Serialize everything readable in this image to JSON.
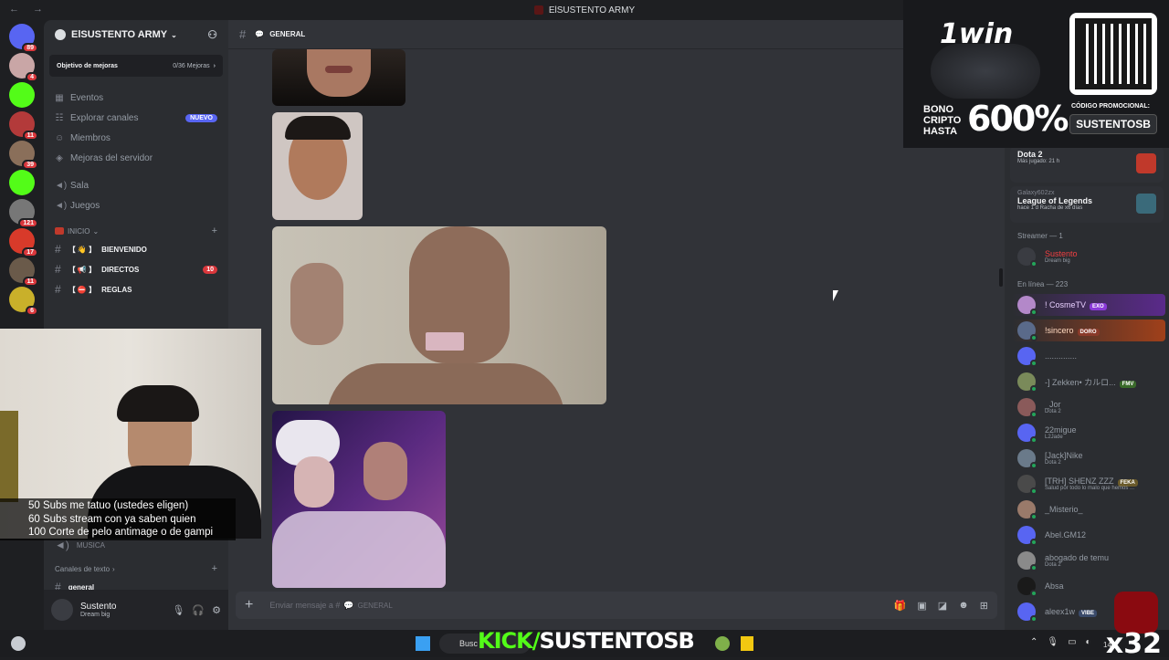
{
  "window": {
    "title": "ElSUSTENTO ARMY",
    "nav": "←  →"
  },
  "servers": [
    {
      "badge": "89",
      "color": "#5865f2"
    },
    {
      "badge": "4",
      "color": "#c9a6a6"
    },
    {
      "badge": "",
      "color": "#53fc18"
    },
    {
      "badge": "11",
      "color": "#b33a3a"
    },
    {
      "badge": "39",
      "color": "#8a6f5a"
    },
    {
      "badge": "",
      "color": "#53fc18"
    },
    {
      "badge": "121",
      "color": "#777"
    },
    {
      "badge": "17",
      "color": "#d83a2a"
    },
    {
      "badge": "11",
      "color": "#6a5a4a"
    },
    {
      "badge": "6",
      "color": "#c9b02a"
    }
  ],
  "sidebar": {
    "server_name": "ElSUSTENTO ARMY",
    "goal": {
      "label": "Objetivo de mejoras",
      "count": "0/36 Mejoras"
    },
    "nav": [
      {
        "label": "Eventos",
        "icon": "calendar-icon",
        "glyph": "▦"
      },
      {
        "label": "Explorar canales",
        "icon": "explore-icon",
        "glyph": "☷",
        "pill": "NUEVO"
      },
      {
        "label": "Miembros",
        "icon": "members-icon",
        "glyph": "☺"
      },
      {
        "label": "Mejoras del servidor",
        "icon": "boost-icon",
        "glyph": "◈"
      }
    ],
    "voice": [
      {
        "label": "Sala",
        "glyph": "◄)"
      },
      {
        "label": "Juegos",
        "glyph": "◄)"
      }
    ],
    "category_inicio": "INICIO",
    "channels": [
      {
        "label": "BIENVENIDO",
        "emoji": "【 👋 】",
        "count": ""
      },
      {
        "label": "DIRECTOS",
        "emoji": "【 📢 】",
        "count": "10"
      },
      {
        "label": "REGLAS",
        "emoji": "【 ⛔ 】",
        "count": ""
      }
    ],
    "channel_musica": "MUSICA",
    "category_text": "Canales de texto",
    "channel_general": "general"
  },
  "user": {
    "name": "Sustento",
    "status": "Dream big"
  },
  "chat": {
    "channel": "GENERAL",
    "composer_placeholder": "Enviar mensaje a #",
    "composer_channel": "GENERAL"
  },
  "members": {
    "activities": [
      {
        "user": "",
        "game": "Dota 2",
        "meta": "Más jugado: 21 h",
        "color": "#c0392b"
      },
      {
        "user": "Galaxy602zx",
        "game": "League of Legends",
        "meta": "hace 1 d   Racha de x6 días",
        "color": "#3a6a7a"
      }
    ],
    "streamer_header": "Streamer — 1",
    "streamer": {
      "name": "Sustento",
      "status": "Dream big"
    },
    "online_header": "En línea — 223",
    "online": [
      {
        "name": "! CosmeTV",
        "status": "",
        "tag": "EXO",
        "tagcolor": "#8a3ad8",
        "avcolor": "#b388c9",
        "glow": "#5a2a8a",
        "namecolor": "#e8d0ff"
      },
      {
        "name": "!sincero",
        "status": "",
        "tag": "DORO",
        "tagcolor": "#8a3a2a",
        "avcolor": "#5a6a8a",
        "glow": "#a0401a",
        "namecolor": "#ffd9c0"
      },
      {
        "name": "..............",
        "status": "",
        "tag": "",
        "tagcolor": "",
        "avcolor": "#5865f2",
        "glow": "",
        "namecolor": "#949ba4"
      },
      {
        "name": "-] Zekken• カルロ...",
        "status": "",
        "tag": "FMV",
        "tagcolor": "#3a6a2a",
        "avcolor": "#7a8a5a",
        "glow": "",
        "namecolor": "#949ba4"
      },
      {
        "name": "_Jor",
        "status": "Dota 2",
        "tag": "",
        "tagcolor": "",
        "avcolor": "#8a5a5a",
        "glow": "",
        "namecolor": "#949ba4"
      },
      {
        "name": "22migue",
        "status": "L2Jade",
        "tag": "",
        "tagcolor": "",
        "avcolor": "#5865f2",
        "glow": "",
        "namecolor": "#949ba4"
      },
      {
        "name": "[Jack]Nike",
        "status": "Dota 2",
        "tag": "",
        "tagcolor": "",
        "avcolor": "#6a7a8a",
        "glow": "",
        "namecolor": "#949ba4"
      },
      {
        "name": "[TRH] SHENZ ZZZ",
        "status": "Salud por todo lo malo que hemos ...",
        "tag": "FEKA",
        "tagcolor": "#6a5a2a",
        "avcolor": "#4a4a4a",
        "glow": "",
        "namecolor": "#949ba4"
      },
      {
        "name": "_Misterio_",
        "status": "",
        "tag": "",
        "tagcolor": "",
        "avcolor": "#9a7a6a",
        "glow": "",
        "namecolor": "#949ba4"
      },
      {
        "name": "Abel.GM12",
        "status": "",
        "tag": "",
        "tagcolor": "",
        "avcolor": "#5865f2",
        "glow": "",
        "namecolor": "#949ba4"
      },
      {
        "name": "abogado de temu",
        "status": "Dota 2",
        "tag": "",
        "tagcolor": "",
        "avcolor": "#8a8a8a",
        "glow": "",
        "namecolor": "#949ba4"
      },
      {
        "name": "Absa",
        "status": "",
        "tag": "",
        "tagcolor": "",
        "avcolor": "#1a1a1a",
        "glow": "",
        "namecolor": "#949ba4"
      },
      {
        "name": "aleex1w",
        "status": "",
        "tag": "VIBE",
        "tagcolor": "#3a4a6a",
        "avcolor": "#5865f2",
        "glow": "",
        "namecolor": "#949ba4"
      }
    ]
  },
  "ad": {
    "brand": "1win",
    "bonus_line1": "BONO",
    "bonus_line2": "CRIPTO",
    "bonus_line3": "HASTA",
    "bonus_pct": "600%",
    "code_label": "CÓDIGO PROMOCIONAL:",
    "code": "SUSTENTOSB"
  },
  "overlay": {
    "subs": [
      "50 Subs me tatuo (ustedes eligen)",
      "60 Subs stream con ya saben quien",
      "100 Corte de pelo antimage o de gampi"
    ],
    "kick_a": "KICK/",
    "kick_b": "SUSTENTOSB",
    "multiplier": "x32"
  },
  "taskbar": {
    "search": "Busc",
    "clock": "14"
  }
}
